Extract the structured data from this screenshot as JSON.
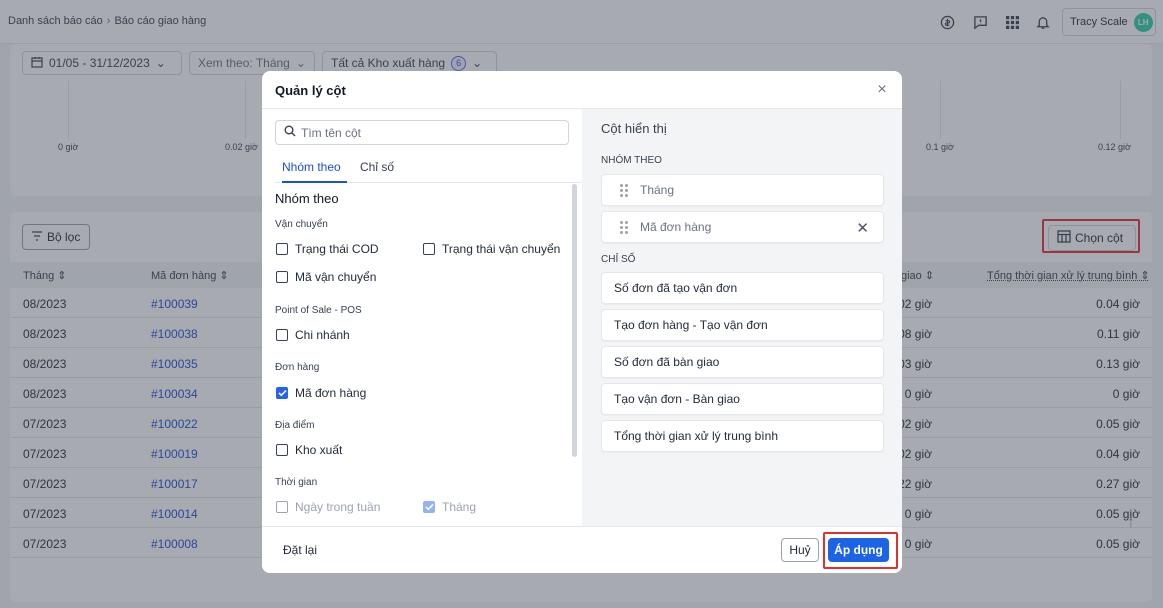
{
  "breadcrumb": [
    "Danh sách báo cáo",
    "Báo cáo giao hàng"
  ],
  "user": {
    "name": "Tracy Scale",
    "initials": "LH"
  },
  "filters": {
    "date_range": "01/05 - 31/12/2023",
    "view_by": "Xem theo: Tháng",
    "warehouse": "Tất cả Kho xuất hàng",
    "warehouse_count": "6"
  },
  "chart": {
    "ticks": [
      "0 giờ",
      "0.02 giờ",
      "0.1 giờ",
      "0.12 giờ"
    ]
  },
  "toolbar": {
    "filter_label": "Bộ lọc",
    "columns_label": "Chọn cột"
  },
  "table": {
    "headers": [
      "Tháng",
      "Mã đơn hàng",
      "giao",
      "Tổng thời gian xử lý trung bình"
    ],
    "rows": [
      {
        "month": "08/2023",
        "order": "#100039",
        "handover": "02 giờ",
        "total": "0.04 giờ"
      },
      {
        "month": "08/2023",
        "order": "#100038",
        "handover": "08 giờ",
        "total": "0.11 giờ"
      },
      {
        "month": "08/2023",
        "order": "#100035",
        "handover": "03 giờ",
        "total": "0.13 giờ"
      },
      {
        "month": "08/2023",
        "order": "#100034",
        "handover": "0 giờ",
        "total": "0 giờ"
      },
      {
        "month": "07/2023",
        "order": "#100022",
        "handover": "02 giờ",
        "total": "0.05 giờ"
      },
      {
        "month": "07/2023",
        "order": "#100019",
        "handover": "02 giờ",
        "total": "0.04 giờ"
      },
      {
        "month": "07/2023",
        "order": "#100017",
        "handover": "22 giờ",
        "total": "0.27 giờ"
      },
      {
        "month": "07/2023",
        "order": "#100014",
        "handover": "0 giờ",
        "total": "0.05 giờ"
      },
      {
        "month": "07/2023",
        "order": "#100008",
        "handover": "0 giờ",
        "total": "0.05 giờ"
      }
    ]
  },
  "modal": {
    "title": "Quản lý cột",
    "search_placeholder": "Tìm tên cột",
    "tabs": [
      "Nhóm theo",
      "Chỉ số"
    ],
    "group_title": "Nhóm theo",
    "sections": {
      "shipping": "Vận chuyển",
      "pos": "Point of Sale - POS",
      "order": "Đơn hàng",
      "location": "Địa điểm",
      "time": "Thời gian"
    },
    "options": {
      "cod_status": "Trạng thái COD",
      "shipping_status": "Trạng thái vận chuyển",
      "shipping_code": "Mã vận chuyển",
      "branch": "Chi nhánh",
      "order_code": "Mã đơn hàng",
      "warehouse": "Kho xuất",
      "weekday": "Ngày trong tuần",
      "month": "Tháng"
    },
    "right_title": "Cột hiển thị",
    "group_section": "NHÓM THEO",
    "group_items": [
      "Tháng",
      "Mã đơn hàng"
    ],
    "metric_section": "CHỈ SỐ",
    "metric_items": [
      "Số đơn đã tạo vận đơn",
      "Tạo đơn hàng - Tạo vận đơn",
      "Số đơn đã bàn giao",
      "Tạo vận đơn - Bàn giao",
      "Tổng thời gian xử lý trung bình"
    ],
    "reset": "Đặt lại",
    "cancel": "Huỷ",
    "apply": "Áp dụng"
  }
}
